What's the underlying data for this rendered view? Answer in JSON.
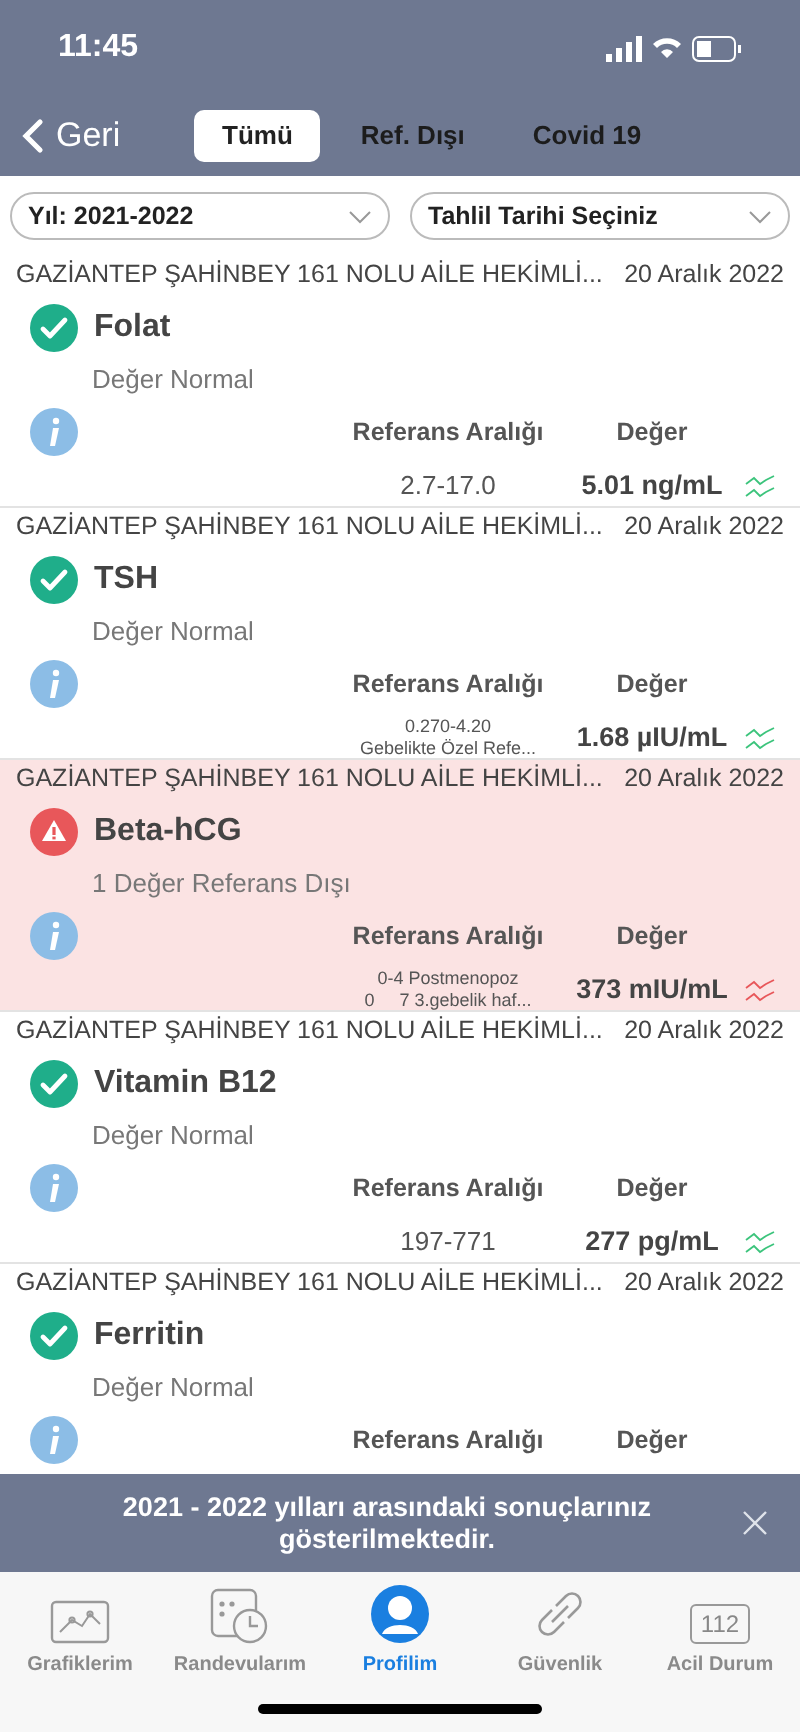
{
  "status_bar": {
    "time": "11:45"
  },
  "nav": {
    "back": "Geri",
    "tabs": [
      {
        "label": "Tümü",
        "selected": true
      },
      {
        "label": "Ref. Dışı",
        "selected": false
      },
      {
        "label": "Covid 19",
        "selected": false
      }
    ]
  },
  "filters": [
    {
      "value": "Yıl: 2021-2022"
    },
    {
      "value": "Tahlil Tarihi Seçiniz"
    }
  ],
  "results": [
    {
      "provider": "GAZİANTEP ŞAHİNBEY 161 NOLU AİLE HEKİMLİ...",
      "date": "20 Aralık 2022",
      "name": "Folat",
      "out_of_range": false,
      "summary": "Değer Normal",
      "reference_label": "Referans Aralığı",
      "value_label": "Değer",
      "reference": [
        "2.7-17.0"
      ],
      "value": "5.01 ng/mL"
    },
    {
      "provider": "GAZİANTEP ŞAHİNBEY 161 NOLU AİLE HEKİMLİ...",
      "date": "20 Aralık 2022",
      "name": "TSH",
      "out_of_range": false,
      "summary": "Değer Normal",
      "reference_label": "Referans Aralığı",
      "value_label": "Değer",
      "reference": [
        "0.270-4.20",
        "Gebelikte Özel Refe..."
      ],
      "value": "1.68 µIU/mL"
    },
    {
      "provider": "GAZİANTEP ŞAHİNBEY 161 NOLU AİLE HEKİMLİ...",
      "date": "20 Aralık 2022",
      "name": "Beta-hCG",
      "out_of_range": true,
      "summary": "1 Değer Referans Dışı",
      "reference_label": "Referans Aralığı",
      "value_label": "Değer",
      "reference": [
        "0-4 Postmenopoz",
        "0     7 3.gebelik haf..."
      ],
      "value": "373 mIU/mL"
    },
    {
      "provider": "GAZİANTEP ŞAHİNBEY 161 NOLU AİLE HEKİMLİ...",
      "date": "20 Aralık 2022",
      "name": "Vitamin B12",
      "out_of_range": false,
      "summary": "Değer Normal",
      "reference_label": "Referans Aralığı",
      "value_label": "Değer",
      "reference": [
        "197-771"
      ],
      "value": "277 pg/mL"
    },
    {
      "provider": "GAZİANTEP ŞAHİNBEY 161 NOLU AİLE HEKİMLİ...",
      "date": "20 Aralık 2022",
      "name": "Ferritin",
      "out_of_range": false,
      "summary": "Değer Normal",
      "reference_label": "Referans Aralığı",
      "value_label": "Değer"
    }
  ],
  "toast": {
    "message": "2021 - 2022 yılları arasındaki sonuçlarınız gösterilmektedir."
  },
  "tab_bar": [
    {
      "kind": "chart",
      "label": "Grafiklerim",
      "selected": false
    },
    {
      "kind": "calendar",
      "label": "Randevularım",
      "selected": false
    },
    {
      "kind": "profile",
      "label": "Profilim",
      "selected": true
    },
    {
      "kind": "link",
      "label": "Güvenlik",
      "selected": false
    },
    {
      "kind": "emergency",
      "label": "Acil Durum",
      "selected": false,
      "badge": "112"
    }
  ]
}
